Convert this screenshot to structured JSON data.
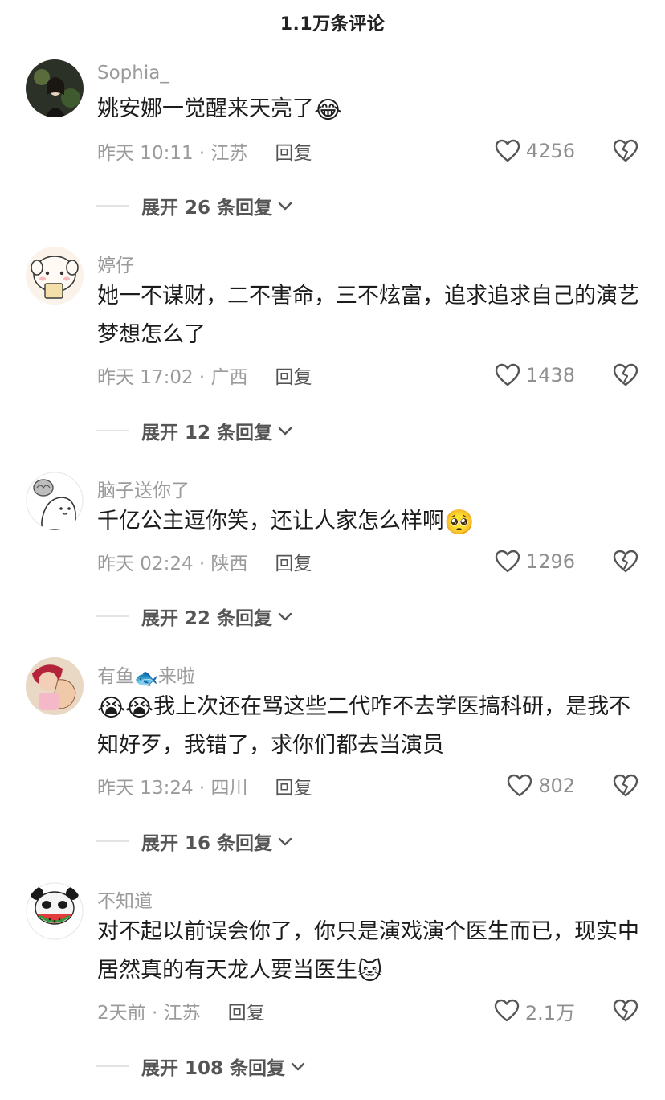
{
  "header": {
    "title": "1.1万条评论"
  },
  "comments": [
    {
      "username": "Sophia_",
      "text": "姚安娜一觉醒来天亮了",
      "emoji": "😂",
      "time": "昨天 10:11 · 江苏",
      "reply_label": "回复",
      "likes": "4256",
      "expand_label": "展开 26 条回复"
    },
    {
      "username": "婷仔",
      "text": "她一不谋财，二不害命，三不炫富，追求追求自己的演艺梦想怎么了",
      "time": "昨天 17:02 · 广西",
      "reply_label": "回复",
      "likes": "1438",
      "expand_label": "展开 12 条回复"
    },
    {
      "username": "脑子送你了",
      "text": "千亿公主逗你笑，还让人家怎么样啊",
      "emoji": "🥺",
      "time": "昨天 02:24 · 陕西",
      "reply_label": "回复",
      "likes": "1296",
      "expand_label": "展开 22 条回复"
    },
    {
      "username": "有鱼",
      "username_emoji": "🐟",
      "username_suffix": "来啦",
      "emoji_prefix": "😭😭",
      "text": "我上次还在骂这些二代咋不去学医搞科研，是我不知好歹，我错了，求你们都去当演员",
      "time": "昨天 13:24 · 四川",
      "reply_label": "回复",
      "likes": "802",
      "expand_label": "展开 16 条回复"
    },
    {
      "username": "不知道",
      "text": "对不起以前误会你了，你只是演戏演个医生而已，现实中居然真的有天龙人要当医生",
      "emoji": "🐱",
      "time": "2天前 · 江苏",
      "reply_label": "回复",
      "likes": "2.1万",
      "expand_label": "展开 108 条回复"
    }
  ]
}
